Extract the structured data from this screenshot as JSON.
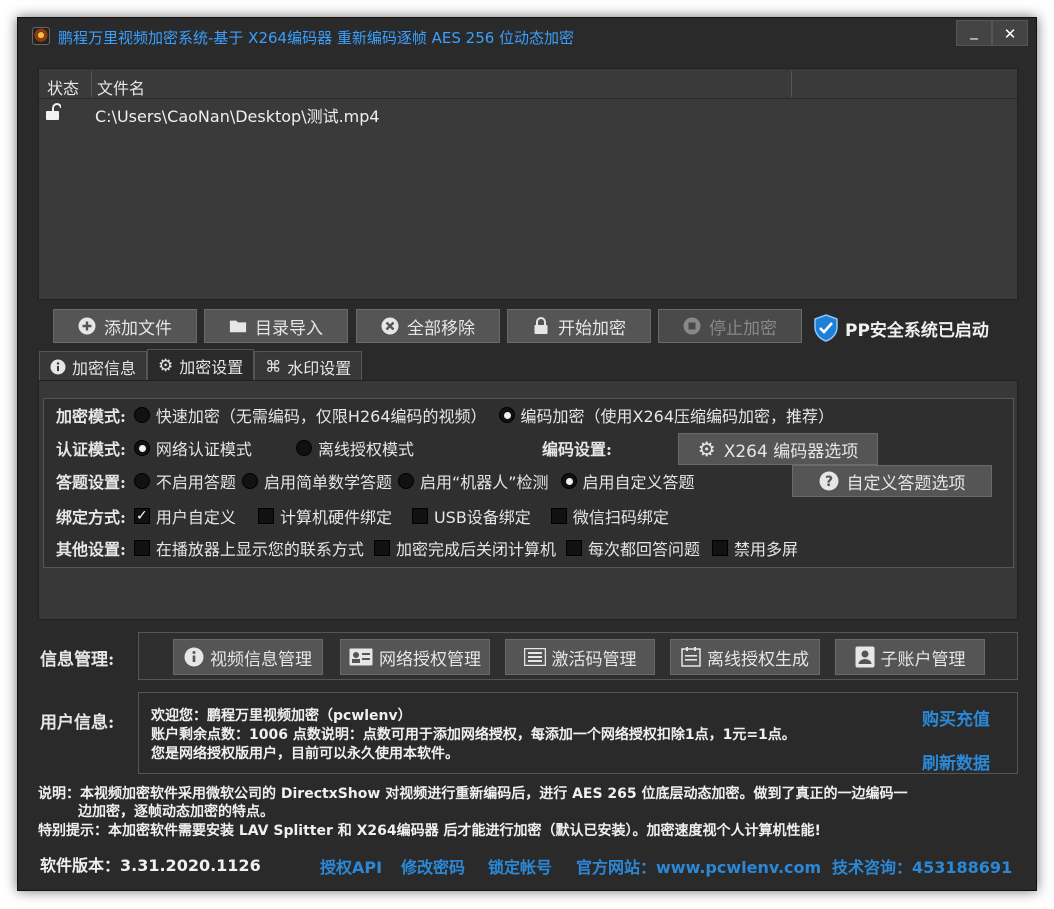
{
  "title": "鹏程万里视频加密系统-基于 X264编码器 重新编码逐帧 AES 256 位动态加密",
  "window": {
    "minimize": "_",
    "close": "✕"
  },
  "filelist": {
    "col_status": "状态",
    "col_filename": "文件名",
    "rows": [
      {
        "status_icon": "unlock-icon",
        "path": "C:\\Users\\CaoNan\\Desktop\\测试.mp4"
      }
    ]
  },
  "toolbar": {
    "add_file": "添加文件",
    "import_dir": "目录导入",
    "remove_all": "全部移除",
    "start": "开始加密",
    "stop": "停止加密",
    "pp_status": "PP安全系统已启动"
  },
  "tabs": [
    "加密信息",
    "加密设置",
    "水印设置"
  ],
  "settings": {
    "mode_label": "加密模式:",
    "mode_fast": "快速加密（无需编码，仅限H264编码的视频）",
    "mode_encode": "编码加密（使用X264压缩编码加密，推荐）",
    "auth_label": "认证模式:",
    "auth_network": "网络认证模式",
    "auth_offline": "离线授权模式",
    "encoder_label": "编码设置:",
    "encoder_button": "X264 编码器选项",
    "quiz_label": "答题设置:",
    "quiz_none": "不启用答题",
    "quiz_math": "启用简单数学答题",
    "quiz_robot": "启用“机器人”检测",
    "quiz_custom": "启用自定义答题",
    "quiz_button": "自定义答题选项",
    "bind_label": "绑定方式:",
    "bind_user": "用户自定义",
    "bind_hw": "计算机硬件绑定",
    "bind_usb": "USB设备绑定",
    "bind_wechat": "微信扫码绑定",
    "other_label": "其他设置:",
    "other_contact": "在播放器上显示您的联系方式",
    "other_shutdown": "加密完成后关闭计算机",
    "other_answer": "每次都回答问题",
    "other_multiscreen": "禁用多屏"
  },
  "info_mgmt": {
    "label": "信息管理:",
    "video": "视频信息管理",
    "network": "网络授权管理",
    "activation": "激活码管理",
    "offline": "离线授权生成",
    "subaccount": "子账户管理"
  },
  "user_info": {
    "label": "用户信息:",
    "line1": "欢迎您：鹏程万里视频加密（pcwlenv）",
    "line2": "账户剩余点数：1006    点数说明：点数可用于添加网络授权，每添加一个网络授权扣除1点，1元=1点。",
    "line3": "您是网络授权版用户，目前可以永久使用本软件。",
    "buy": "购买充值",
    "refresh": "刷新数据"
  },
  "notes": {
    "line1": "说明：本视频加密软件采用微软公司的 DirectxShow 对视频进行重新编码后，进行 AES 265 位底层动态加密。做到了真正的一边编码一",
    "line2": "边加密，逐帧动态加密的特点。",
    "line3": "特别提示：本加密软件需要安装 LAV Splitter 和 X264编码器 后才能进行加密（默认已安装）。加密速度视个人计算机性能!"
  },
  "footer": {
    "version": "软件版本：3.31.2020.1126",
    "api": "授权API",
    "password": "修改密码",
    "lock": "锁定帐号",
    "website": "官方网站：www.pcwlenv.com",
    "support": "技术咨询：453188691"
  }
}
